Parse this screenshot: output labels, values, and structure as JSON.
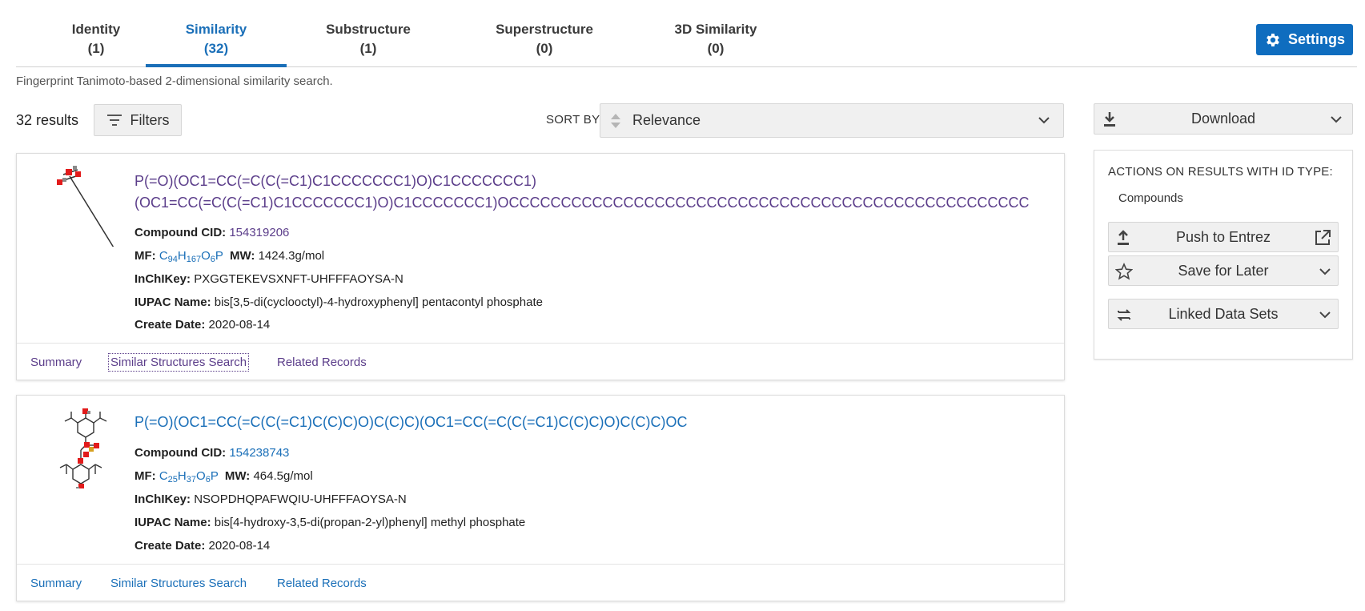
{
  "tabs": [
    {
      "name": "Identity",
      "count": "(1)"
    },
    {
      "name": "Similarity",
      "count": "(32)"
    },
    {
      "name": "Substructure",
      "count": "(1)"
    },
    {
      "name": "Superstructure",
      "count": "(0)"
    },
    {
      "name": "3D Similarity",
      "count": "(0)"
    }
  ],
  "settings_label": "Settings",
  "subtitle": "Fingerprint Tanimoto-based 2-dimensional similarity search.",
  "results": {
    "count_label": "32 results",
    "filters_label": "Filters",
    "sortby_label": "SORT BY",
    "sort_value": "Relevance"
  },
  "download_label": "Download",
  "actions": {
    "title": "ACTIONS ON RESULTS WITH ID TYPE:",
    "id_type": "Compounds",
    "push_label": "Push to Entrez",
    "save_label": "Save for Later",
    "linked_label": "Linked Data Sets"
  },
  "labels": {
    "cid": "Compound CID:",
    "mf": "MF:",
    "mw": "MW:",
    "inchikey": "InChIKey:",
    "iupac": "IUPAC Name:",
    "date": "Create Date:"
  },
  "cards": [
    {
      "title_line1": "P(=O)(OC1=CC(=C(C(=C1)C1CCCCCCC1)O)C1CCCCCCC1)",
      "title_line2": "(OC1=CC(=C(C(=C1)C1CCCCCCC1)O)C1CCCCCCC1)OCCCCCCCCCCCCCCCCCCCCCCCCCCCCCCCCCCCCCCCCCCCCCCCCCC",
      "cid": "154319206",
      "mf_parts": [
        "C",
        "94",
        "H",
        "167",
        "O",
        "6",
        "P"
      ],
      "mw": "1424.3g/mol",
      "inchikey": "PXGGTEKEVSXNFT-UHFFFAOYSA-N",
      "iupac": "bis[3,5-di(cyclooctyl)-4-hydroxyphenyl] pentacontyl phosphate",
      "date": "2020-08-14"
    },
    {
      "title_line1": "P(=O)(OC1=CC(=C(C(=C1)C(C)C)O)C(C)C)(OC1=CC(=C(C(=C1)C(C)C)O)C(C)C)OC",
      "cid": "154238743",
      "mf_parts": [
        "C",
        "25",
        "H",
        "37",
        "O",
        "6",
        "P"
      ],
      "mw": "464.5g/mol",
      "inchikey": "NSOPDHQPAFWQIU-UHFFFAOYSA-N",
      "iupac": "bis[4-hydroxy-3,5-di(propan-2-yl)phenyl] methyl phosphate",
      "date": "2020-08-14"
    }
  ],
  "footer_links": {
    "summary": "Summary",
    "similar": "Similar Structures Search",
    "related": "Related Records"
  },
  "colors": {
    "accent": "#1a6fb8",
    "visited": "#5b3d8a",
    "button_bg": "#f0f0f0"
  }
}
